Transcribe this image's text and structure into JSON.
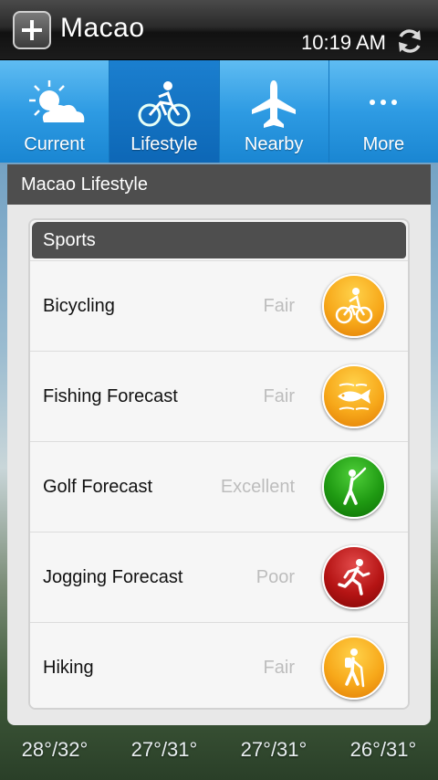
{
  "header": {
    "city": "Macao",
    "time": "10:19 AM"
  },
  "tabs": [
    {
      "label": "Current",
      "icon": "sun-cloud-icon",
      "active": false
    },
    {
      "label": "Lifestyle",
      "icon": "bicycle-icon",
      "active": true
    },
    {
      "label": "Nearby",
      "icon": "airplane-icon",
      "active": false
    },
    {
      "label": "More",
      "icon": "more-dots-icon",
      "active": false
    }
  ],
  "panel": {
    "title": "Macao Lifestyle",
    "section": "Sports",
    "items": [
      {
        "name": "Bicycling",
        "rating": "Fair",
        "icon": "cyclist-icon",
        "color": "#f7a81a"
      },
      {
        "name": "Fishing Forecast",
        "rating": "Fair",
        "icon": "fish-icon",
        "color": "#f7a81a"
      },
      {
        "name": "Golf Forecast",
        "rating": "Excellent",
        "icon": "golfer-icon",
        "color": "#1f9a12"
      },
      {
        "name": "Jogging Forecast",
        "rating": "Poor",
        "icon": "runner-icon",
        "color": "#b51414"
      },
      {
        "name": "Hiking",
        "rating": "Fair",
        "icon": "hiker-icon",
        "color": "#f7a81a"
      }
    ]
  },
  "forecast_temps": [
    "28°/32°",
    "27°/31°",
    "27°/31°",
    "26°/31°"
  ]
}
